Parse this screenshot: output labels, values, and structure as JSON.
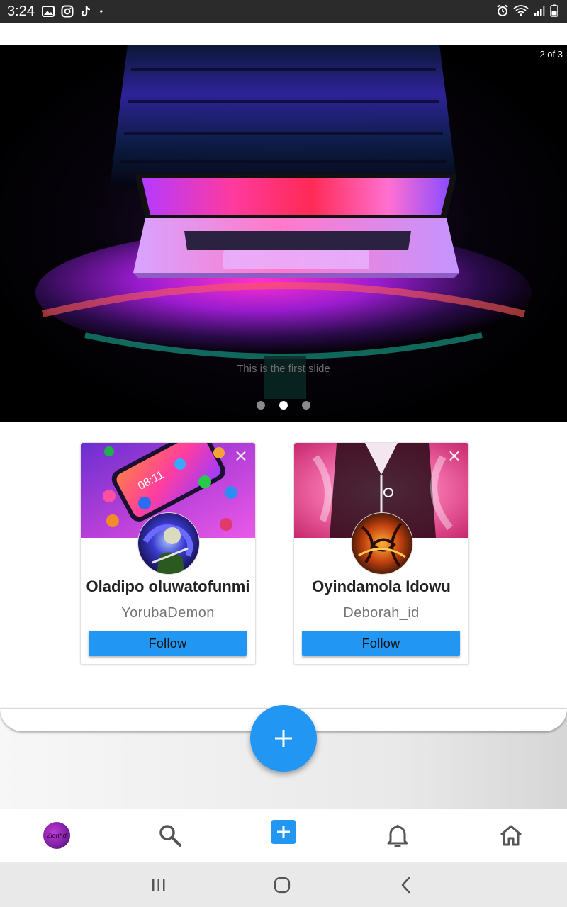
{
  "status_bar": {
    "time": "3:24",
    "left_icons": [
      "gallery-icon",
      "instagram-icon",
      "tiktok-icon",
      "dot-icon"
    ],
    "right_icons": [
      "alarm-icon",
      "wifi-icon",
      "signal-icon",
      "battery-icon"
    ]
  },
  "carousel": {
    "counter": "2 of 3",
    "caption": "This is the first slide",
    "slide_count": 3,
    "active_index": 1
  },
  "suggestions": [
    {
      "name": "Oladipo oluwatofunmi",
      "username": "YorubaDemon",
      "follow_label": "Follow",
      "close_icon": "×"
    },
    {
      "name": "Oyindamola Idowu",
      "username": "Deborah_id",
      "follow_label": "Follow",
      "close_icon": "×"
    }
  ],
  "fab": {
    "icon": "plus-icon"
  },
  "bottom_nav": {
    "items": [
      "profile-avatar",
      "search-icon",
      "add-square-icon",
      "bell-icon",
      "home-icon"
    ],
    "avatar_text": "Zionhd"
  },
  "system_nav": {
    "items": [
      "recents-icon",
      "home-circle-icon",
      "back-icon"
    ]
  },
  "colors": {
    "accent": "#2196f3",
    "status_bar": "#2b2b2b",
    "system_nav": "#e9e9e9"
  }
}
